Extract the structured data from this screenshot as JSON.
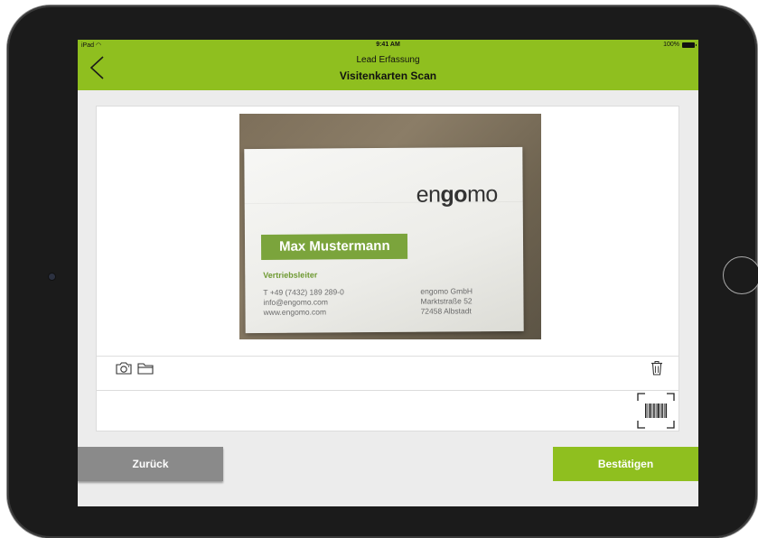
{
  "status_bar": {
    "carrier": "iPad",
    "time": "9:41 AM",
    "battery": "100%"
  },
  "navbar": {
    "subtitle": "Lead Erfassung",
    "title": "Visitenkarten Scan"
  },
  "business_card": {
    "company_logo": "engomo",
    "name": "Max Mustermann",
    "job_title": "Vertriebsleiter",
    "phone": "T  +49 (7432) 189 289-0",
    "email": "info@engomo.com",
    "website": "www.engomo.com",
    "company": "engomo GmbH",
    "street": "Marktstraße 52",
    "city": "72458 Albstadt"
  },
  "toolbar": {
    "icons": [
      "camera-icon",
      "folder-icon",
      "trash-icon"
    ]
  },
  "barcode_panel": {
    "icon": "barcode-scan-icon"
  },
  "buttons": {
    "back_label": "Zurück",
    "confirm_label": "Bestätigen"
  },
  "colors": {
    "accent": "#8fbf1f",
    "secondary_button": "#8a8a8a",
    "card_green": "#7ba43c"
  }
}
